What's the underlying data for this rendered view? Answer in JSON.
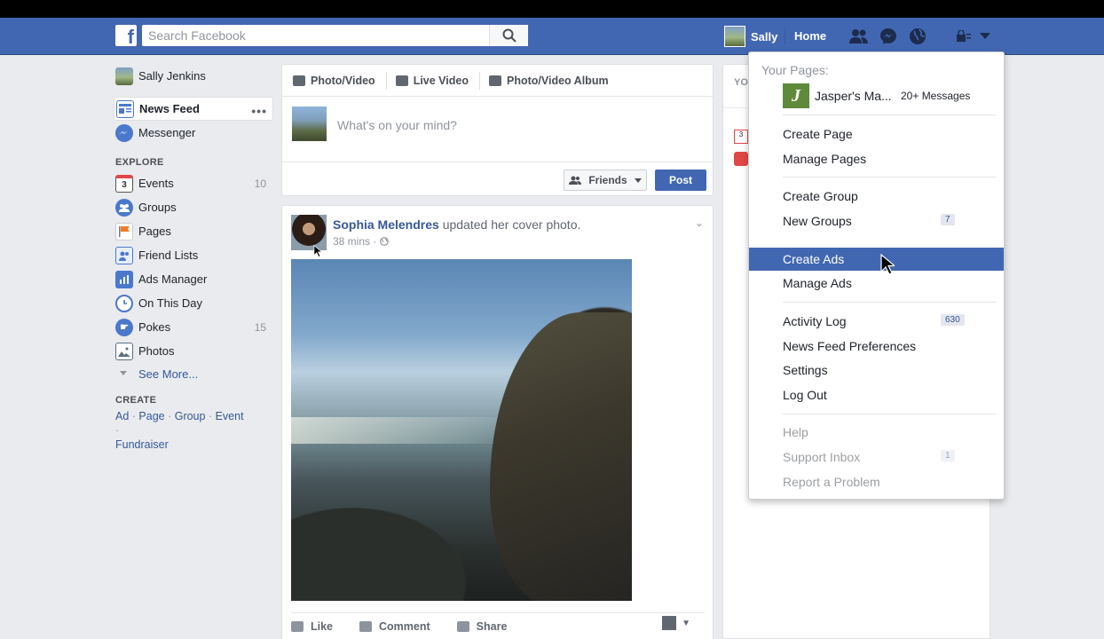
{
  "header": {
    "search_placeholder": "Search Facebook",
    "user_name": "Sally",
    "home_label": "Home"
  },
  "leftnav": {
    "profile_name": "Sally Jenkins",
    "news_feed": "News Feed",
    "messenger": "Messenger",
    "explore_heading": "EXPLORE",
    "items": [
      {
        "label": "Events",
        "count": "10",
        "icon": "calendar-icon",
        "color": "#e04848"
      },
      {
        "label": "Groups",
        "count": "",
        "icon": "groups-icon",
        "color": "#4a78cc"
      },
      {
        "label": "Pages",
        "count": "",
        "icon": "flag-icon",
        "color": "#f07a2a"
      },
      {
        "label": "Friend Lists",
        "count": "",
        "icon": "friend-list-icon",
        "color": "#4a78cc"
      },
      {
        "label": "Ads Manager",
        "count": "",
        "icon": "ads-manager-icon",
        "color": "#4a78cc"
      },
      {
        "label": "On This Day",
        "count": "",
        "icon": "clock-icon",
        "color": "#4a78cc"
      },
      {
        "label": "Pokes",
        "count": "15",
        "icon": "poke-icon",
        "color": "#4a78cc"
      },
      {
        "label": "Photos",
        "count": "",
        "icon": "photos-icon",
        "color": "#5b6e83"
      }
    ],
    "see_more": "See More...",
    "create_heading": "CREATE",
    "create_links": {
      "ad": "Ad",
      "page": "Page",
      "group": "Group",
      "event": "Event",
      "fundraiser": "Fundraiser"
    }
  },
  "composer": {
    "tabs": [
      "Photo/Video",
      "Live Video",
      "Photo/Video Album"
    ],
    "placeholder": "What's on your mind?",
    "audience": "Friends",
    "post_label": "Post"
  },
  "story": {
    "author": "Sophia Melendres",
    "action": "updated her cover photo.",
    "time": "38 mins ·",
    "actions": {
      "like": "Like",
      "comment": "Comment",
      "share": "Share"
    }
  },
  "rightcol": {
    "heading": "YOU"
  },
  "menu": {
    "your_pages": "Your Pages:",
    "page_name": "Jasper's Ma...",
    "page_badge": "20+ Messages",
    "items": {
      "create_page": "Create Page",
      "manage_pages": "Manage Pages",
      "create_group": "Create Group",
      "new_groups": "New Groups",
      "new_groups_count": "7",
      "create_ads": "Create Ads",
      "manage_ads": "Manage Ads",
      "activity_log": "Activity Log",
      "activity_log_count": "630",
      "news_feed_prefs": "News Feed Preferences",
      "settings": "Settings",
      "log_out": "Log Out",
      "help": "Help",
      "support_inbox": "Support Inbox",
      "support_inbox_count": "1",
      "report_problem": "Report a Problem"
    }
  },
  "colors": {
    "brand": "#4267b2",
    "background": "#e9ebee",
    "link": "#365899"
  }
}
